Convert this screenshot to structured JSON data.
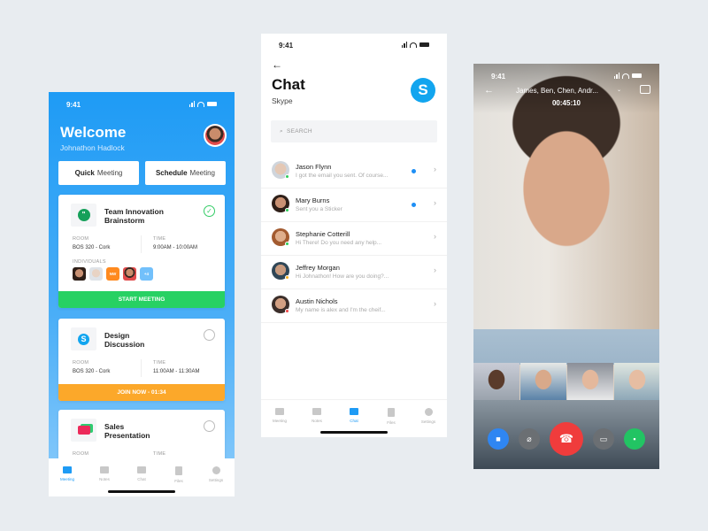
{
  "meeting_app": {
    "status_time": "9:41",
    "welcome": "Welcome",
    "user_name": "Johnathon Hadlock",
    "quick_meeting": {
      "bold": "Quick",
      "rest": "Meeting"
    },
    "schedule_meeting": {
      "bold": "Schedule",
      "rest": "Meeting"
    },
    "labels": {
      "room": "ROOM",
      "time": "TIME",
      "individuals": "INDIVIDUALS"
    },
    "meetings": [
      {
        "title_line1": "Team Innovation",
        "title_line2": "Brainstorm",
        "icon": "hangouts-icon",
        "room": "BOS 320 - Cork",
        "time": "9:00AM - 10:00AM",
        "done": true,
        "action": "START MEETING",
        "action_color": "#27d163",
        "individuals": [
          "avatar",
          "avatar",
          "NW",
          "avatar",
          "+4"
        ]
      },
      {
        "title_line1": "Design",
        "title_line2": "Discussion",
        "icon": "skype-icon",
        "room": "BOS 320 - Cork",
        "time": "11:00AM - 11:30AM",
        "done": false,
        "action": "JOIN NOW - 01:34",
        "action_color": "#fca82a"
      },
      {
        "title_line1": "Sales",
        "title_line2": "Presentation",
        "icon": "video-chat-icon",
        "done": false
      }
    ],
    "tabs": [
      "Meeting",
      "Notes",
      "Chat",
      "Files",
      "Settings"
    ],
    "active_tab": "Meeting"
  },
  "chat_app": {
    "status_time": "9:41",
    "title": "Chat",
    "subtitle": "Skype",
    "search_placeholder": "SEARCH",
    "contacts": [
      {
        "name": "Jason Flynn",
        "message": "I got the email you sent. Of course...",
        "status_color": "#2ecc5a",
        "unread": true
      },
      {
        "name": "Mary Burns",
        "message": "Sent you a Sticker",
        "status_color": "#2ecc5a",
        "unread": true
      },
      {
        "name": "Stephanie Cotterill",
        "message": "Hi There! Do you need any help...",
        "status_color": "#2ecc5a",
        "unread": false
      },
      {
        "name": "Jeffrey Morgan",
        "message": "Hi Johnathon! How are you doing?...",
        "status_color": "#f5b021",
        "unread": false
      },
      {
        "name": "Austin Nichols",
        "message": "My name is alex and I'm the cheif...",
        "status_color": "#f04545",
        "unread": false
      }
    ],
    "tabs": [
      "Meeting",
      "Notes",
      "Chat",
      "Files",
      "Settings"
    ],
    "active_tab": "Chat"
  },
  "call_app": {
    "status_time": "9:41",
    "participants": "James, Ben, Chen, Andr...",
    "duration": "00:45:10",
    "controls": [
      {
        "name": "video",
        "color": "#2f86f2"
      },
      {
        "name": "mute-mic",
        "color": "#6b6f73"
      },
      {
        "name": "end-call",
        "color": "#f03c3c"
      },
      {
        "name": "screen-share",
        "color": "#6b6f73"
      },
      {
        "name": "chat",
        "color": "#22c463"
      }
    ]
  }
}
